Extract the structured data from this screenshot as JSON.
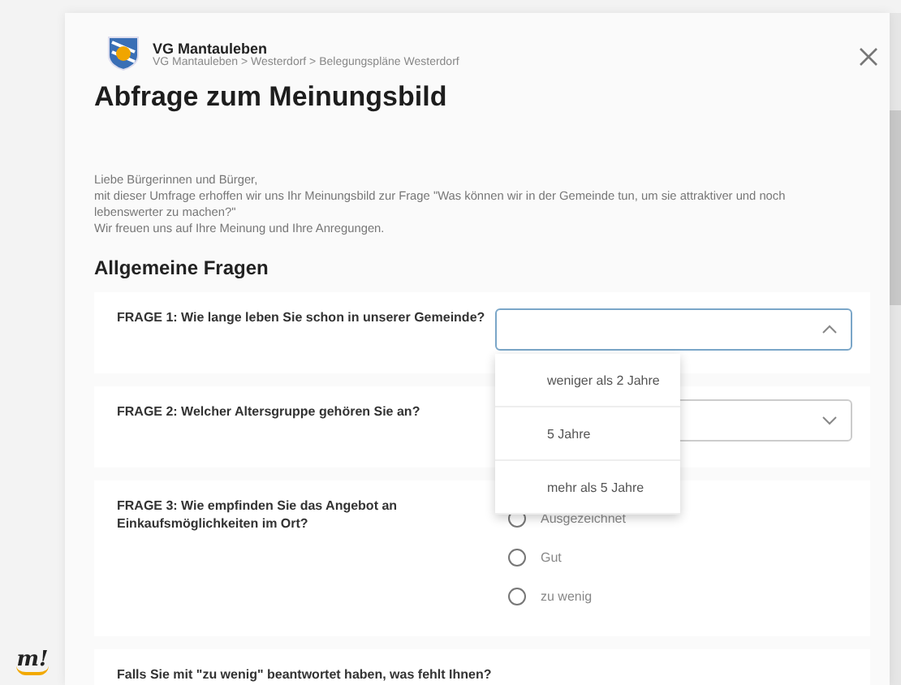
{
  "sidebar": {
    "logo_text": "m!"
  },
  "header": {
    "title": "VG Mantauleben",
    "breadcrumb": "VG Mantauleben > Westerdorf > Belegungspläne Westerdorf"
  },
  "heading": "Abfrage zum Meinungsbild",
  "intro": [
    "Liebe Bürgerinnen und Bürger,",
    "mit dieser Umfrage erhoffen wir uns Ihr Meinungsbild zur Frage \"Was können wir in der Gemeinde tun, um sie attraktiver und noch lebenswerter zu machen?\"",
    "Wir freuen uns auf Ihre Meinung und Ihre Anregungen."
  ],
  "section_title": "Allgemeine Fragen",
  "questions": [
    {
      "kind": "select",
      "label": "FRAGE 1: Wie lange leben Sie schon in unserer Gemeinde?",
      "expanded": true,
      "options": [
        "weniger als 2 Jahre",
        "5 Jahre",
        "mehr als 5 Jahre"
      ]
    },
    {
      "kind": "select",
      "label": "FRAGE 2: Welcher Altersgruppe gehören Sie an?",
      "expanded": false
    },
    {
      "kind": "radio",
      "label": "FRAGE 3: Wie empfinden Sie das Angebot an Einkaufsmöglichkeiten im Ort?",
      "options": [
        {
          "label": "Ausgezeichnet",
          "selected": false
        },
        {
          "label": "Gut",
          "selected": false
        },
        {
          "label": "zu wenig",
          "selected": false
        }
      ]
    },
    {
      "kind": "text",
      "label": "Falls Sie mit \"zu wenig\" beantwortet haben, was fehlt Ihnen?"
    }
  ]
}
